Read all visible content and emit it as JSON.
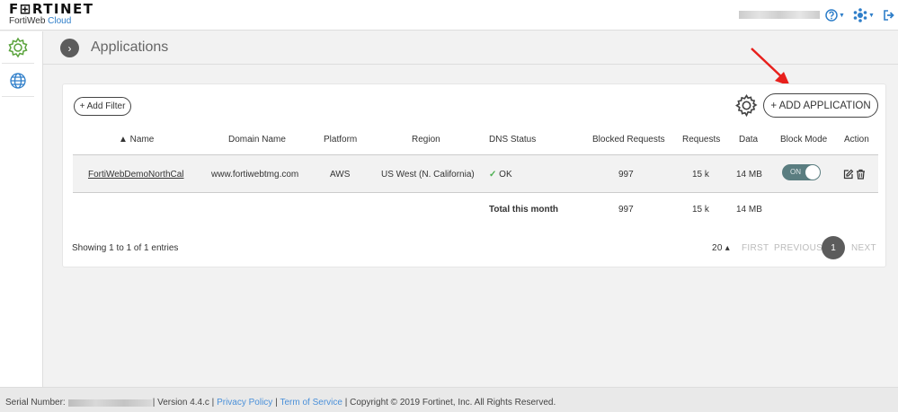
{
  "header": {
    "brand": "F⊞RTINET",
    "product": "FortiWeb",
    "product_cloud": "Cloud",
    "icons": [
      "help-icon",
      "settings-network-icon",
      "logout-icon"
    ]
  },
  "sidebar": {
    "items": [
      {
        "icon": "application-gear-icon",
        "active": true
      },
      {
        "icon": "globe-icon",
        "active": false
      }
    ]
  },
  "page": {
    "title": "Applications"
  },
  "toolbar": {
    "add_filter": "+ Add Filter",
    "add_application": "+ ADD APPLICATION"
  },
  "table": {
    "columns": [
      "▲ Name",
      "Domain Name",
      "Platform",
      "Region",
      "DNS Status",
      "Blocked Requests",
      "Requests",
      "Data",
      "Block Mode",
      "Action"
    ],
    "rows": [
      {
        "name": "FortiWebDemoNorthCal",
        "domain": "www.fortiwebtmg.com",
        "platform": "AWS",
        "region": "US West (N. California)",
        "dns_status": "OK",
        "blocked_requests": "997",
        "requests": "15 k",
        "data": "14 MB",
        "block_mode": "ON"
      }
    ],
    "total": {
      "label": "Total this month",
      "blocked_requests": "997",
      "requests": "15 k",
      "data": "14 MB"
    }
  },
  "pagination": {
    "showing": "Showing 1 to 1 of 1 entries",
    "page_size": "20 ▴",
    "first": "FIRST",
    "previous": "PREVIOUS",
    "current": "1",
    "next": "NEXT"
  },
  "footer": {
    "serial_label": "Serial Number:",
    "version": "| Version 4.4.c |",
    "privacy": "Privacy Policy",
    "sep": "|",
    "terms": "Term of Service",
    "copyright": "| Copyright © 2019 Fortinet, Inc. All Rights Reserved."
  },
  "colors": {
    "accent_blue": "#2e7ec9",
    "sidebar_active_green": "#5aa33c",
    "ok_green": "#4caf50",
    "toggle_on": "#5a7d80",
    "annotation_red": "#e8201c"
  }
}
